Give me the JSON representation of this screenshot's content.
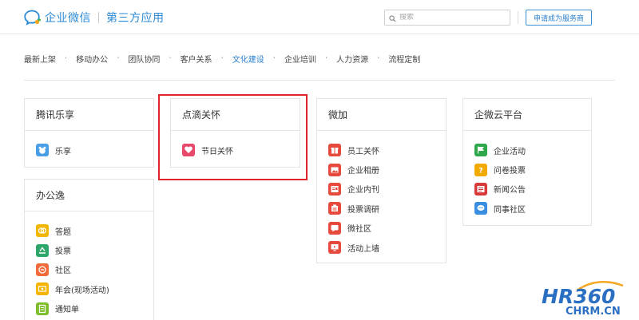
{
  "header": {
    "brand": "企业微信",
    "sub_title": "第三方应用",
    "search_placeholder": "搜索",
    "apply_button": "申请成为服务商"
  },
  "nav": {
    "items": [
      {
        "label": "最新上架",
        "active": false
      },
      {
        "label": "移动办公",
        "active": false
      },
      {
        "label": "团队协同",
        "active": false
      },
      {
        "label": "客户关系",
        "active": false
      },
      {
        "label": "文化建设",
        "active": true
      },
      {
        "label": "企业培训",
        "active": false
      },
      {
        "label": "人力资源",
        "active": false
      },
      {
        "label": "流程定制",
        "active": false
      }
    ]
  },
  "cards": {
    "tencent": {
      "title": "腾讯乐享",
      "apps": [
        {
          "label": "乐享",
          "icon": "bear-icon",
          "color": "#4a9ee8"
        }
      ]
    },
    "dianDi": {
      "title": "点滴关怀",
      "apps": [
        {
          "label": "节日关怀",
          "icon": "heart-icon",
          "color": "#e8496a"
        }
      ]
    },
    "bangongyi": {
      "title": "办公逸",
      "apps": [
        {
          "label": "答题",
          "icon": "quiz-icon",
          "color": "#f2b600"
        },
        {
          "label": "投票",
          "icon": "vote-icon",
          "color": "#2ea66a"
        },
        {
          "label": "社区",
          "icon": "community-icon",
          "color": "#f06a3a"
        },
        {
          "label": "年会(现场活动)",
          "icon": "party-icon",
          "color": "#f4b400"
        },
        {
          "label": "通知单",
          "icon": "notice-icon",
          "color": "#7dbf2a"
        }
      ]
    },
    "weijia": {
      "title": "微加",
      "apps": [
        {
          "label": "员工关怀",
          "icon": "gift-icon",
          "color": "#e64a3c"
        },
        {
          "label": "企业相册",
          "icon": "album-icon",
          "color": "#e64a3c"
        },
        {
          "label": "企业内刊",
          "icon": "magazine-icon",
          "color": "#e64a3c"
        },
        {
          "label": "投票调研",
          "icon": "survey-icon",
          "color": "#e64a3c"
        },
        {
          "label": "微社区",
          "icon": "chat-icon",
          "color": "#e64a3c"
        },
        {
          "label": "活动上墙",
          "icon": "screen-icon",
          "color": "#e64a3c"
        }
      ]
    },
    "qiweiyun": {
      "title": "企微云平台",
      "apps": [
        {
          "label": "企业活动",
          "icon": "flag-icon",
          "color": "#2ea64a"
        },
        {
          "label": "问卷投票",
          "icon": "questionnaire-icon",
          "color": "#f2a900"
        },
        {
          "label": "新闻公告",
          "icon": "news-icon",
          "color": "#d83a3a"
        },
        {
          "label": "同事社区",
          "icon": "colleague-icon",
          "color": "#3a8ee0"
        }
      ]
    }
  },
  "watermark": {
    "line1": "HR360",
    "line2": "CHRM.CN"
  }
}
